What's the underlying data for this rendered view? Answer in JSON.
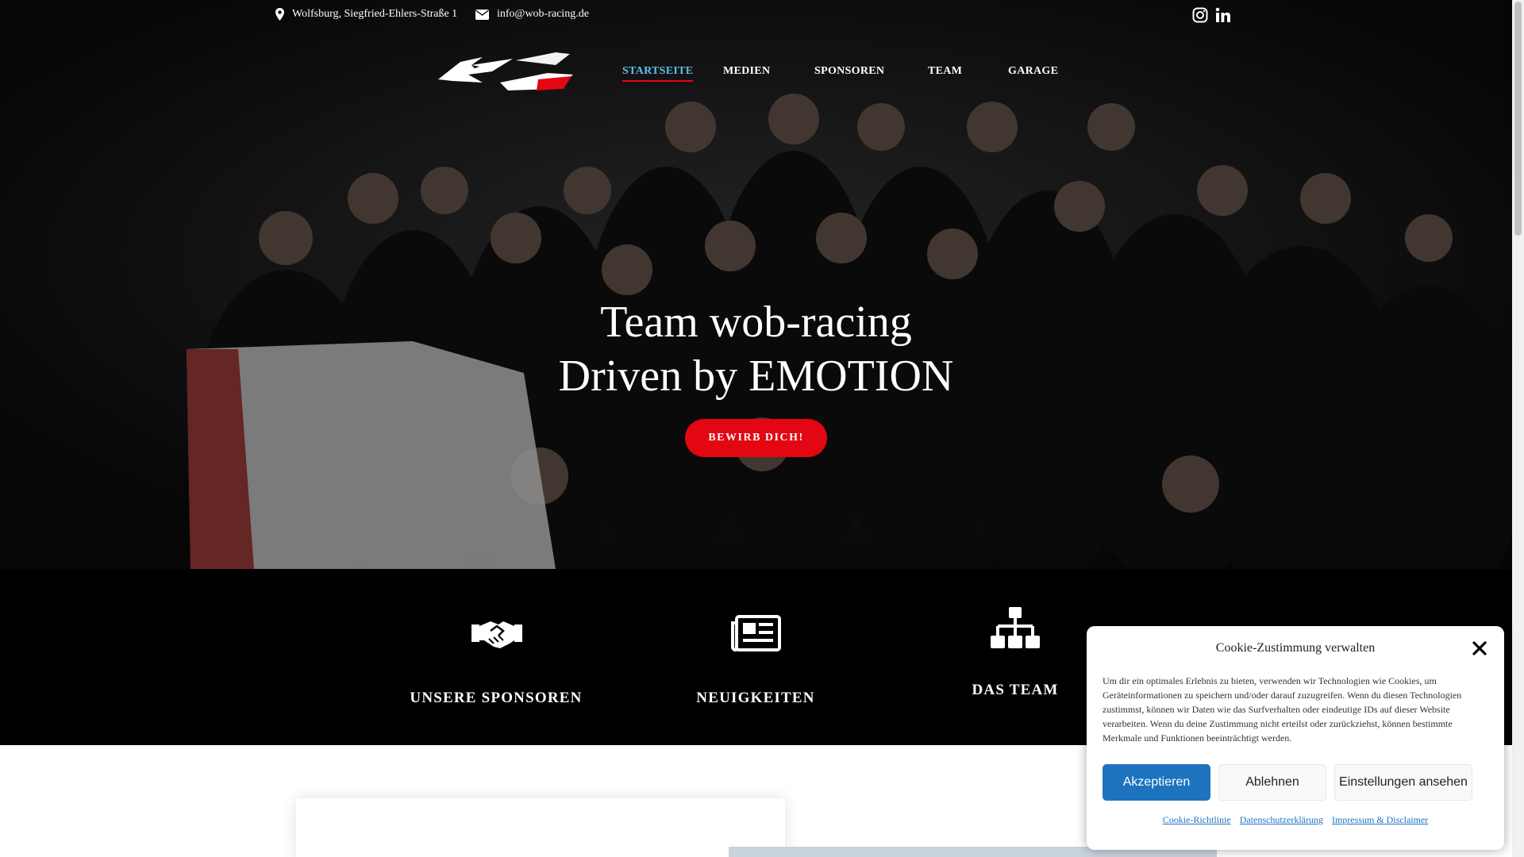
{
  "topbar": {
    "address": "Wolfsburg, Siegfried-Ehlers-Straße 1",
    "email": "info@wob-racing.de",
    "address_icon": "map-pin-icon",
    "email_icon": "envelope-icon",
    "social": [
      "instagram-icon",
      "linkedin-icon"
    ]
  },
  "nav": {
    "items": [
      {
        "label": "STARTSEITE",
        "active": true
      },
      {
        "label": "MEDIEN",
        "active": false
      },
      {
        "label": "SPONSOREN",
        "active": false
      },
      {
        "label": "TEAM",
        "active": false
      },
      {
        "label": "GARAGE",
        "active": false
      }
    ],
    "active_color": "#62bdf1"
  },
  "hero": {
    "title_line1": "Team wob-racing",
    "title_line2": "Driven by EMOTION",
    "cta_label": "BEWIRB DICH!",
    "cta_color": "#e30613"
  },
  "features": [
    {
      "label": "UNSERE SPONSOREN",
      "icon": "handshake-icon"
    },
    {
      "label": "NEUIGKEITEN",
      "icon": "newspaper-icon"
    },
    {
      "label": "DAS TEAM",
      "icon": "org-chart-icon"
    }
  ],
  "cookie": {
    "title": "Cookie-Zustimmung verwalten",
    "text": "Um dir ein optimales Erlebnis zu bieten, verwenden wir Technologien wie Cookies, um Geräteinformationen zu speichern und/oder darauf zuzugreifen. Wenn du diesen Technologien zustimmst, können wir Daten wie das Surfverhalten oder eindeutige IDs auf dieser Website verarbeiten. Wenn du deine Zustimmung nicht erteilst oder zurückziehst, können bestimmte Merkmale und Funktionen beeinträchtigt werden.",
    "accept": "Akzeptieren",
    "deny": "Ablehnen",
    "preferences": "Einstellungen ansehen",
    "links": [
      "Cookie-Richtlinie",
      "Datenschutzerklärung",
      "Impressum & Disclaimer"
    ],
    "accent_color": "#1e73be"
  }
}
